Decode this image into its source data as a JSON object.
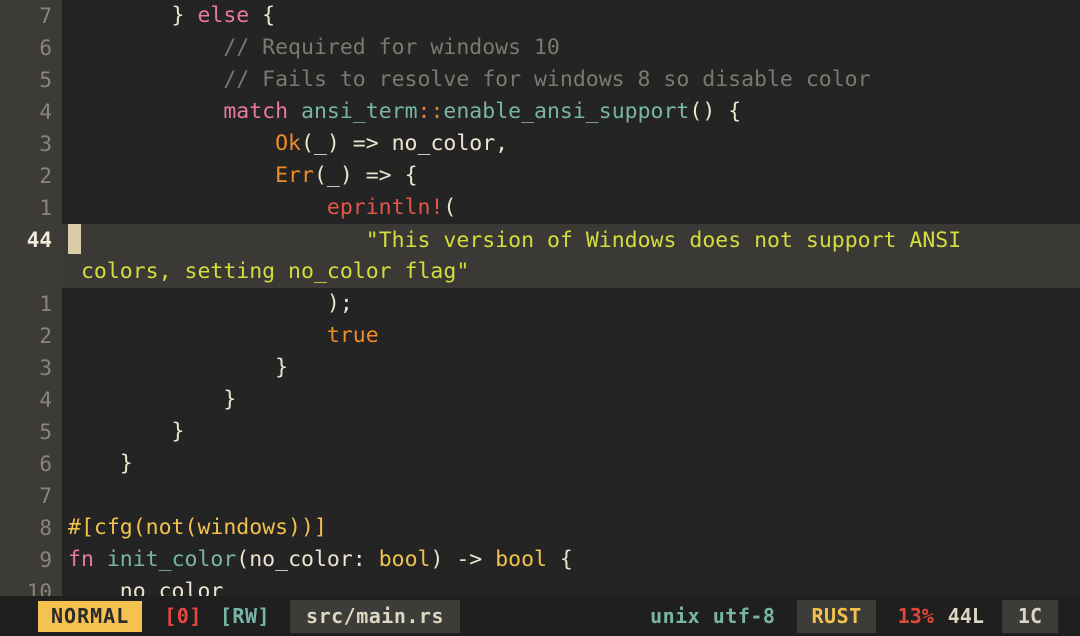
{
  "editor": {
    "filetype": "rust",
    "gutter_color": "#3d3b36",
    "background_color": "#232423",
    "cursor_color": "#d9cda7",
    "current_line_bg": "#3b3935",
    "lines": [
      {
        "num": "7",
        "current": false,
        "segments": [
          {
            "t": "        } ",
            "c": "c-punct"
          },
          {
            "t": "else",
            "c": "c-kw"
          },
          {
            "t": " {",
            "c": "c-punct"
          }
        ]
      },
      {
        "num": "6",
        "current": false,
        "segments": [
          {
            "t": "            // Required for windows 10",
            "c": "c-com"
          }
        ]
      },
      {
        "num": "5",
        "current": false,
        "segments": [
          {
            "t": "            // Fails to resolve for windows 8 so disable color",
            "c": "c-com"
          }
        ]
      },
      {
        "num": "4",
        "current": false,
        "segments": [
          {
            "t": "            ",
            "c": "c-punct"
          },
          {
            "t": "match",
            "c": "c-kw"
          },
          {
            "t": " ",
            "c": "c-punct"
          },
          {
            "t": "ansi_term",
            "c": "c-fn"
          },
          {
            "t": "::",
            "c": "c-op"
          },
          {
            "t": "enable_ansi_support",
            "c": "c-fn"
          },
          {
            "t": "() {",
            "c": "c-punct"
          }
        ]
      },
      {
        "num": "3",
        "current": false,
        "segments": [
          {
            "t": "                ",
            "c": "c-punct"
          },
          {
            "t": "Ok",
            "c": "c-enum"
          },
          {
            "t": "(_) ",
            "c": "c-punct"
          },
          {
            "t": "=>",
            "c": "c-punct"
          },
          {
            "t": " no_color,",
            "c": "c-plain"
          }
        ]
      },
      {
        "num": "2",
        "current": false,
        "segments": [
          {
            "t": "                ",
            "c": "c-punct"
          },
          {
            "t": "Err",
            "c": "c-enum"
          },
          {
            "t": "(_) ",
            "c": "c-punct"
          },
          {
            "t": "=>",
            "c": "c-punct"
          },
          {
            "t": " {",
            "c": "c-punct"
          }
        ]
      },
      {
        "num": "1",
        "current": false,
        "segments": [
          {
            "t": "                    ",
            "c": "c-punct"
          },
          {
            "t": "eprintln!",
            "c": "c-macro"
          },
          {
            "t": "(",
            "c": "c-punct"
          }
        ]
      },
      {
        "num": "44",
        "current": true,
        "cursor": true,
        "segments": [
          {
            "t": "                      \"This version of Windows does not support ANSI",
            "c": "c-str"
          }
        ]
      },
      {
        "num": "",
        "current": true,
        "wrap": true,
        "segments": [
          {
            "t": " colors, setting no_color flag\"",
            "c": "c-str"
          }
        ]
      },
      {
        "num": "1",
        "current": false,
        "segments": [
          {
            "t": "                    );",
            "c": "c-punct"
          }
        ]
      },
      {
        "num": "2",
        "current": false,
        "segments": [
          {
            "t": "                    ",
            "c": "c-punct"
          },
          {
            "t": "true",
            "c": "c-num"
          }
        ]
      },
      {
        "num": "3",
        "current": false,
        "segments": [
          {
            "t": "                }",
            "c": "c-punct"
          }
        ]
      },
      {
        "num": "4",
        "current": false,
        "segments": [
          {
            "t": "            }",
            "c": "c-punct"
          }
        ]
      },
      {
        "num": "5",
        "current": false,
        "segments": [
          {
            "t": "        }",
            "c": "c-punct"
          }
        ]
      },
      {
        "num": "6",
        "current": false,
        "segments": [
          {
            "t": "    }",
            "c": "c-punct"
          }
        ]
      },
      {
        "num": "7",
        "current": false,
        "segments": [
          {
            "t": "",
            "c": "c-punct"
          }
        ]
      },
      {
        "num": "8",
        "current": false,
        "segments": [
          {
            "t": "#[cfg(not(windows))]",
            "c": "c-attr"
          }
        ]
      },
      {
        "num": "9",
        "current": false,
        "segments": [
          {
            "t": "fn",
            "c": "c-kw"
          },
          {
            "t": " ",
            "c": "c-punct"
          },
          {
            "t": "init_color",
            "c": "c-fn"
          },
          {
            "t": "(no_color: ",
            "c": "c-plain"
          },
          {
            "t": "bool",
            "c": "c-attr"
          },
          {
            "t": ") ",
            "c": "c-punct"
          },
          {
            "t": "->",
            "c": "c-punct"
          },
          {
            "t": " ",
            "c": "c-punct"
          },
          {
            "t": "bool",
            "c": "c-attr"
          },
          {
            "t": " {",
            "c": "c-punct"
          }
        ]
      },
      {
        "num": "10",
        "current": false,
        "segments": [
          {
            "t": "    no_color",
            "c": "c-plain"
          }
        ]
      }
    ]
  },
  "statusline": {
    "mode": "NORMAL",
    "search_count": "[0]",
    "readwrite": "[RW]",
    "filepath": "src/main.rs",
    "fileformat_encoding": "unix utf-8",
    "language": "RUST",
    "percent": "13%",
    "total_lines": "44L",
    "column": "1C",
    "mode_bg": "#f5c151",
    "accent_red": "#e2483c",
    "accent_teal": "#79b5a6",
    "accent_yellow": "#f2c14e"
  }
}
